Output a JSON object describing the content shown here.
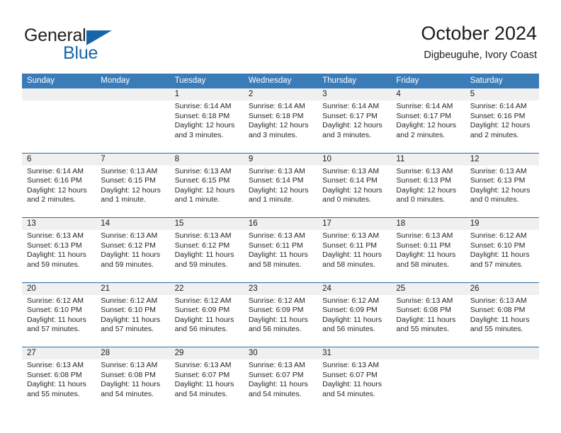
{
  "brand": {
    "name_part1": "General",
    "name_part2": "Blue",
    "logo_icon": "triangle-logo-icon",
    "colors": {
      "blue": "#1565a8",
      "dark": "#222222"
    }
  },
  "header": {
    "title": "October 2024",
    "subtitle": "Digbeuguhe, Ivory Coast"
  },
  "calendar": {
    "header_bg": "#3a7cb8",
    "row_divider": "#2a6ca8",
    "day_band_bg": "#f0f0f0",
    "weekdays": [
      "Sunday",
      "Monday",
      "Tuesday",
      "Wednesday",
      "Thursday",
      "Friday",
      "Saturday"
    ],
    "weeks": [
      [
        {
          "day": "",
          "empty": true
        },
        {
          "day": "",
          "empty": true
        },
        {
          "day": "1",
          "sunrise": "Sunrise: 6:14 AM",
          "sunset": "Sunset: 6:18 PM",
          "daylight": "Daylight: 12 hours and 3 minutes."
        },
        {
          "day": "2",
          "sunrise": "Sunrise: 6:14 AM",
          "sunset": "Sunset: 6:18 PM",
          "daylight": "Daylight: 12 hours and 3 minutes."
        },
        {
          "day": "3",
          "sunrise": "Sunrise: 6:14 AM",
          "sunset": "Sunset: 6:17 PM",
          "daylight": "Daylight: 12 hours and 3 minutes."
        },
        {
          "day": "4",
          "sunrise": "Sunrise: 6:14 AM",
          "sunset": "Sunset: 6:17 PM",
          "daylight": "Daylight: 12 hours and 2 minutes."
        },
        {
          "day": "5",
          "sunrise": "Sunrise: 6:14 AM",
          "sunset": "Sunset: 6:16 PM",
          "daylight": "Daylight: 12 hours and 2 minutes."
        }
      ],
      [
        {
          "day": "6",
          "sunrise": "Sunrise: 6:14 AM",
          "sunset": "Sunset: 6:16 PM",
          "daylight": "Daylight: 12 hours and 2 minutes."
        },
        {
          "day": "7",
          "sunrise": "Sunrise: 6:13 AM",
          "sunset": "Sunset: 6:15 PM",
          "daylight": "Daylight: 12 hours and 1 minute."
        },
        {
          "day": "8",
          "sunrise": "Sunrise: 6:13 AM",
          "sunset": "Sunset: 6:15 PM",
          "daylight": "Daylight: 12 hours and 1 minute."
        },
        {
          "day": "9",
          "sunrise": "Sunrise: 6:13 AM",
          "sunset": "Sunset: 6:14 PM",
          "daylight": "Daylight: 12 hours and 1 minute."
        },
        {
          "day": "10",
          "sunrise": "Sunrise: 6:13 AM",
          "sunset": "Sunset: 6:14 PM",
          "daylight": "Daylight: 12 hours and 0 minutes."
        },
        {
          "day": "11",
          "sunrise": "Sunrise: 6:13 AM",
          "sunset": "Sunset: 6:13 PM",
          "daylight": "Daylight: 12 hours and 0 minutes."
        },
        {
          "day": "12",
          "sunrise": "Sunrise: 6:13 AM",
          "sunset": "Sunset: 6:13 PM",
          "daylight": "Daylight: 12 hours and 0 minutes."
        }
      ],
      [
        {
          "day": "13",
          "sunrise": "Sunrise: 6:13 AM",
          "sunset": "Sunset: 6:13 PM",
          "daylight": "Daylight: 11 hours and 59 minutes."
        },
        {
          "day": "14",
          "sunrise": "Sunrise: 6:13 AM",
          "sunset": "Sunset: 6:12 PM",
          "daylight": "Daylight: 11 hours and 59 minutes."
        },
        {
          "day": "15",
          "sunrise": "Sunrise: 6:13 AM",
          "sunset": "Sunset: 6:12 PM",
          "daylight": "Daylight: 11 hours and 59 minutes."
        },
        {
          "day": "16",
          "sunrise": "Sunrise: 6:13 AM",
          "sunset": "Sunset: 6:11 PM",
          "daylight": "Daylight: 11 hours and 58 minutes."
        },
        {
          "day": "17",
          "sunrise": "Sunrise: 6:13 AM",
          "sunset": "Sunset: 6:11 PM",
          "daylight": "Daylight: 11 hours and 58 minutes."
        },
        {
          "day": "18",
          "sunrise": "Sunrise: 6:13 AM",
          "sunset": "Sunset: 6:11 PM",
          "daylight": "Daylight: 11 hours and 58 minutes."
        },
        {
          "day": "19",
          "sunrise": "Sunrise: 6:12 AM",
          "sunset": "Sunset: 6:10 PM",
          "daylight": "Daylight: 11 hours and 57 minutes."
        }
      ],
      [
        {
          "day": "20",
          "sunrise": "Sunrise: 6:12 AM",
          "sunset": "Sunset: 6:10 PM",
          "daylight": "Daylight: 11 hours and 57 minutes."
        },
        {
          "day": "21",
          "sunrise": "Sunrise: 6:12 AM",
          "sunset": "Sunset: 6:10 PM",
          "daylight": "Daylight: 11 hours and 57 minutes."
        },
        {
          "day": "22",
          "sunrise": "Sunrise: 6:12 AM",
          "sunset": "Sunset: 6:09 PM",
          "daylight": "Daylight: 11 hours and 56 minutes."
        },
        {
          "day": "23",
          "sunrise": "Sunrise: 6:12 AM",
          "sunset": "Sunset: 6:09 PM",
          "daylight": "Daylight: 11 hours and 56 minutes."
        },
        {
          "day": "24",
          "sunrise": "Sunrise: 6:12 AM",
          "sunset": "Sunset: 6:09 PM",
          "daylight": "Daylight: 11 hours and 56 minutes."
        },
        {
          "day": "25",
          "sunrise": "Sunrise: 6:13 AM",
          "sunset": "Sunset: 6:08 PM",
          "daylight": "Daylight: 11 hours and 55 minutes."
        },
        {
          "day": "26",
          "sunrise": "Sunrise: 6:13 AM",
          "sunset": "Sunset: 6:08 PM",
          "daylight": "Daylight: 11 hours and 55 minutes."
        }
      ],
      [
        {
          "day": "27",
          "sunrise": "Sunrise: 6:13 AM",
          "sunset": "Sunset: 6:08 PM",
          "daylight": "Daylight: 11 hours and 55 minutes."
        },
        {
          "day": "28",
          "sunrise": "Sunrise: 6:13 AM",
          "sunset": "Sunset: 6:08 PM",
          "daylight": "Daylight: 11 hours and 54 minutes."
        },
        {
          "day": "29",
          "sunrise": "Sunrise: 6:13 AM",
          "sunset": "Sunset: 6:07 PM",
          "daylight": "Daylight: 11 hours and 54 minutes."
        },
        {
          "day": "30",
          "sunrise": "Sunrise: 6:13 AM",
          "sunset": "Sunset: 6:07 PM",
          "daylight": "Daylight: 11 hours and 54 minutes."
        },
        {
          "day": "31",
          "sunrise": "Sunrise: 6:13 AM",
          "sunset": "Sunset: 6:07 PM",
          "daylight": "Daylight: 11 hours and 54 minutes."
        },
        {
          "day": "",
          "empty": true
        },
        {
          "day": "",
          "empty": true
        }
      ]
    ]
  }
}
